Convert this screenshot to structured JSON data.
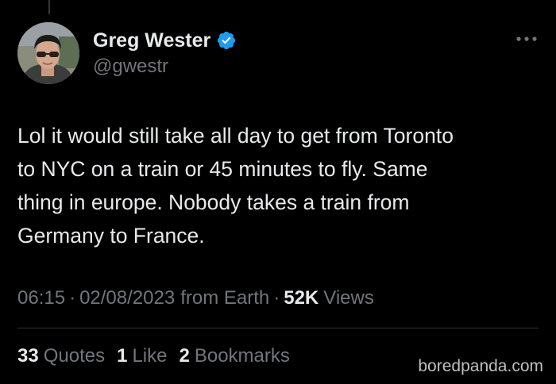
{
  "author": {
    "name": "Greg Wester",
    "handle": "@gwestr",
    "verified": true,
    "avatar_icon": "profile-photo-man-sunglasses"
  },
  "tweet": {
    "text": "Lol it would still take all day to get from Toronto\nto NYC on a train or 45 minutes to fly. Same\nthing in europe. Nobody takes a train from\nGermany to France."
  },
  "meta": {
    "time": "06:15",
    "separator": "·",
    "date": "02/08/2023",
    "source": "from Earth",
    "views_count": "52K",
    "views_label": "Views"
  },
  "stats": [
    {
      "count": "33",
      "label": "Quotes"
    },
    {
      "count": "1",
      "label": "Like"
    },
    {
      "count": "2",
      "label": "Bookmarks"
    }
  ],
  "watermark": "boredpanda.com",
  "colors": {
    "background": "#000000",
    "text_primary": "#e7e9ea",
    "text_secondary": "#71767b",
    "verified_blue": "#1d9bf0",
    "divider": "#2f3336"
  }
}
